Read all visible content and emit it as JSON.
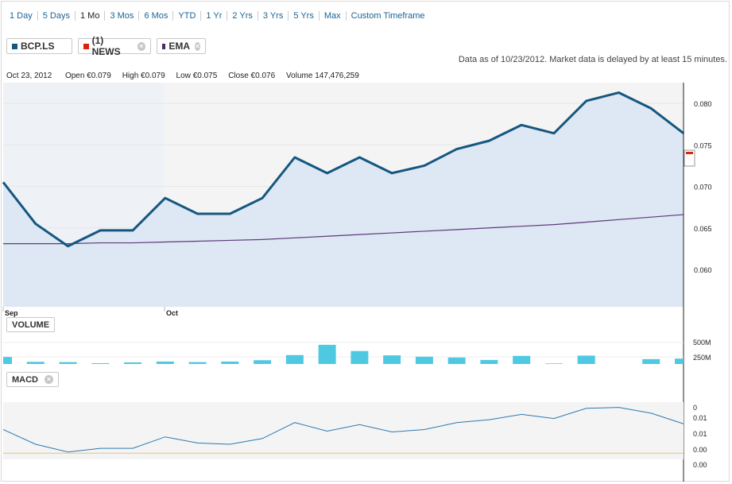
{
  "timeframes": [
    "1 Day",
    "5 Days",
    "1 Mo",
    "3 Mos",
    "6 Mos",
    "YTD",
    "1 Yr",
    "2 Yrs",
    "3 Yrs",
    "5 Yrs",
    "Max",
    "Custom Timeframe"
  ],
  "active_timeframe": "1 Mo",
  "chips": {
    "symbol": {
      "label": "BCP.LS",
      "color": "#15577f"
    },
    "news": {
      "label": "(1) NEWS",
      "color": "#d9230f"
    },
    "ema": {
      "label": "EMA",
      "color": "#4b2a6b"
    }
  },
  "as_of": "Data as of 10/23/2012. Market data is delayed by at least 15 minutes.",
  "ohlc": {
    "date": "Oct 23, 2012",
    "open_label": "Open",
    "open": "€0.079",
    "high_label": "High",
    "high": "€0.079",
    "low_label": "Low",
    "low": "€0.075",
    "close_label": "Close",
    "close": "€0.076",
    "volume_label": "Volume",
    "volume": "147,476,259"
  },
  "panels": {
    "volume": "VOLUME",
    "macd": "MACD"
  },
  "colors": {
    "price": "#15577f",
    "area": "#dbe6f4",
    "ema": "#5b3a78",
    "volume": "#4fc9e2",
    "macd": "#2a7ab0",
    "zero": "#e8c36b"
  },
  "chart_data": {
    "type": "line",
    "x_labels": [
      "Sep",
      "Oct"
    ],
    "y_ticks": [
      "0.080",
      "0.075",
      "0.070",
      "0.065",
      "0.060"
    ],
    "ylim": [
      0.0555,
      0.0825
    ],
    "price": [
      0.0705,
      0.0655,
      0.0628,
      0.0647,
      0.0647,
      0.0686,
      0.0667,
      0.0667,
      0.0686,
      0.0735,
      0.0716,
      0.0735,
      0.0716,
      0.0725,
      0.0745,
      0.0755,
      0.0774,
      0.0764,
      0.0803,
      0.0813,
      0.0794,
      0.0764
    ],
    "ema": [
      0.0631,
      0.0631,
      0.0631,
      0.0632,
      0.0632,
      0.0633,
      0.0634,
      0.0635,
      0.0636,
      0.0638,
      0.064,
      0.0642,
      0.0644,
      0.0646,
      0.0648,
      0.065,
      0.0652,
      0.0654,
      0.0657,
      0.066,
      0.0663,
      0.0666
    ],
    "volume": {
      "ticks": [
        "500M",
        "250M"
      ],
      "values": [
        260,
        80,
        70,
        30,
        60,
        90,
        70,
        90,
        140,
        330,
        710,
        480,
        320,
        270,
        240,
        150,
        300,
        20,
        310,
        0,
        180,
        200
      ],
      "max": 1000
    },
    "macd": {
      "ticks": [
        "0",
        "0.01",
        "0.01",
        "0.00",
        "0.00",
        "0.00"
      ],
      "values": [
        0.0058,
        0.0022,
        0.0003,
        0.0012,
        0.0012,
        0.004,
        0.0025,
        0.0022,
        0.0036,
        0.0075,
        0.0054,
        0.007,
        0.0052,
        0.0058,
        0.0075,
        0.0082,
        0.0095,
        0.0085,
        0.011,
        0.0112,
        0.0098,
        0.0072
      ],
      "zero": 0.0
    }
  }
}
